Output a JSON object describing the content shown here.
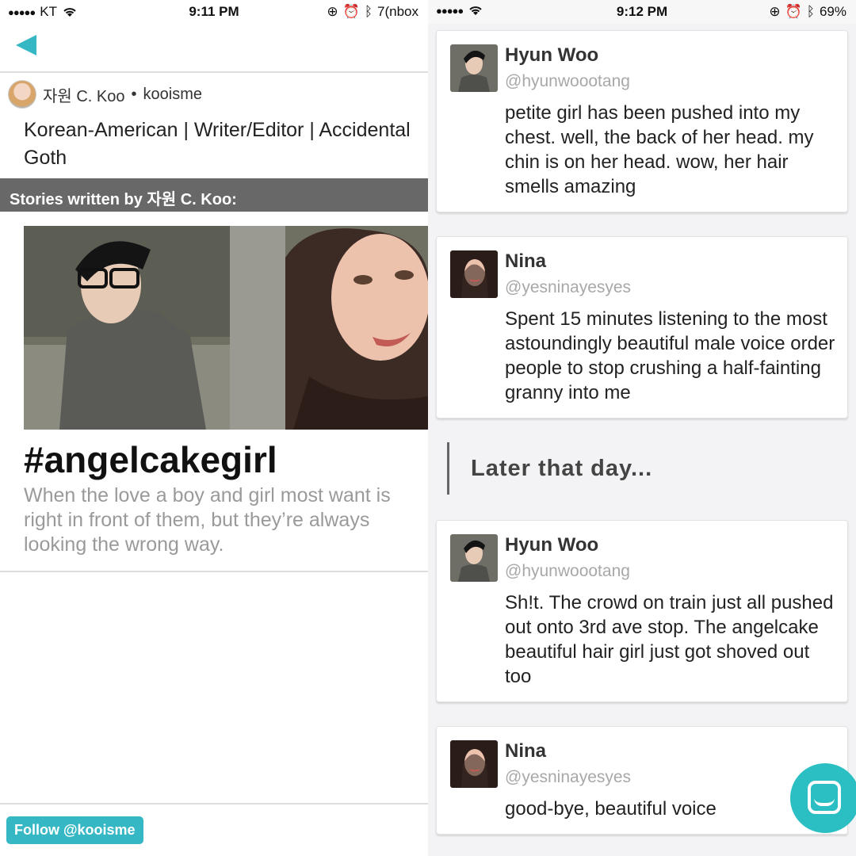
{
  "left_panel": {
    "status_bar": {
      "carrier": "KT",
      "time": "9:11 PM",
      "right_text": "7(nbox"
    },
    "author": {
      "name": "자원 C. Koo",
      "separator": "•",
      "username": "kooisme"
    },
    "bio": "Korean-American | Writer/Editor | Accidental Goth",
    "section_header": "Stories written by 자원 C. Koo:",
    "story": {
      "title": "#angelcakegirl",
      "description": "When the love a boy and girl most want is right in front of them, but they’re always looking the wrong way."
    },
    "follow_button": "Follow @kooisme",
    "accent_color": "#35b8c4"
  },
  "right_panel": {
    "status_bar": {
      "time": "9:12 PM",
      "battery": "69%"
    },
    "messages": [
      {
        "name": "Hyun Woo",
        "handle": "@hyunwoootang",
        "text": "petite girl has been pushed into my chest. well, the back of her head. my chin is on her head. wow, her hair smells amazing"
      },
      {
        "name": "Nina",
        "handle": "@yesninayesyes",
        "text": "Spent 15 minutes listening to the most astoundingly beautiful male voice order people to stop crushing a half-fainting granny into me"
      },
      {
        "name": "Hyun Woo",
        "handle": "@hyunwoootang",
        "text": "Sh!t. The crowd on train just all pushed out onto 3rd ave stop. The angelcake beautiful hair girl just got shoved out too"
      },
      {
        "name": "Nina",
        "handle": "@yesninayesyes",
        "text": "good-bye, beautiful voice"
      }
    ],
    "interlude": "Later that day...",
    "chat_button_color": "#2bbfc4"
  }
}
